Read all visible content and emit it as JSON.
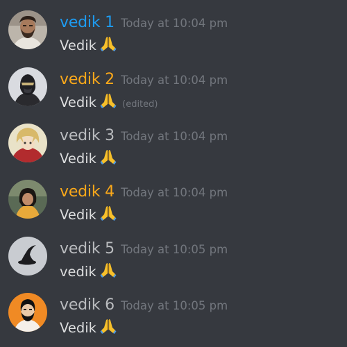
{
  "colors": {
    "background": "#36393f",
    "username_blue": "#1e9bf0",
    "username_orange": "#faa81a",
    "username_gray": "#b9bbbe",
    "timestamp": "#72767d",
    "message_text": "#dcddde"
  },
  "messages": [
    {
      "username": "vedik 1",
      "username_color": "#1e9bf0",
      "timestamp": "Today at 10:04 pm",
      "text": "Vedik",
      "emoji": "folded-hands-icon",
      "edited_label": "",
      "avatar": "bearded-man-avatar"
    },
    {
      "username": "vedik 2",
      "username_color": "#faa81a",
      "timestamp": "Today at 10:04 pm",
      "text": "Vedik",
      "emoji": "folded-hands-icon",
      "edited_label": "(edited)",
      "avatar": "masked-figure-avatar"
    },
    {
      "username": "vedik 3",
      "username_color": "#b9bbbe",
      "timestamp": "Today at 10:04 pm",
      "text": "Vedik",
      "emoji": "folded-hands-icon",
      "edited_label": "",
      "avatar": "anime-character-avatar"
    },
    {
      "username": "vedik 4",
      "username_color": "#faa81a",
      "timestamp": "Today at 10:04 pm",
      "text": "Vedik",
      "emoji": "folded-hands-icon",
      "edited_label": "",
      "avatar": "girl-photo-avatar"
    },
    {
      "username": "vedik 5",
      "username_color": "#b9bbbe",
      "timestamp": "Today at 10:05 pm",
      "text": "vedik",
      "emoji": "folded-hands-icon",
      "edited_label": "",
      "avatar": "witch-hat-avatar"
    },
    {
      "username": "vedik 6",
      "username_color": "#b9bbbe",
      "timestamp": "Today at 10:05 pm",
      "text": "Vedik",
      "emoji": "folded-hands-icon",
      "edited_label": "",
      "avatar": "cartoon-man-avatar"
    }
  ]
}
